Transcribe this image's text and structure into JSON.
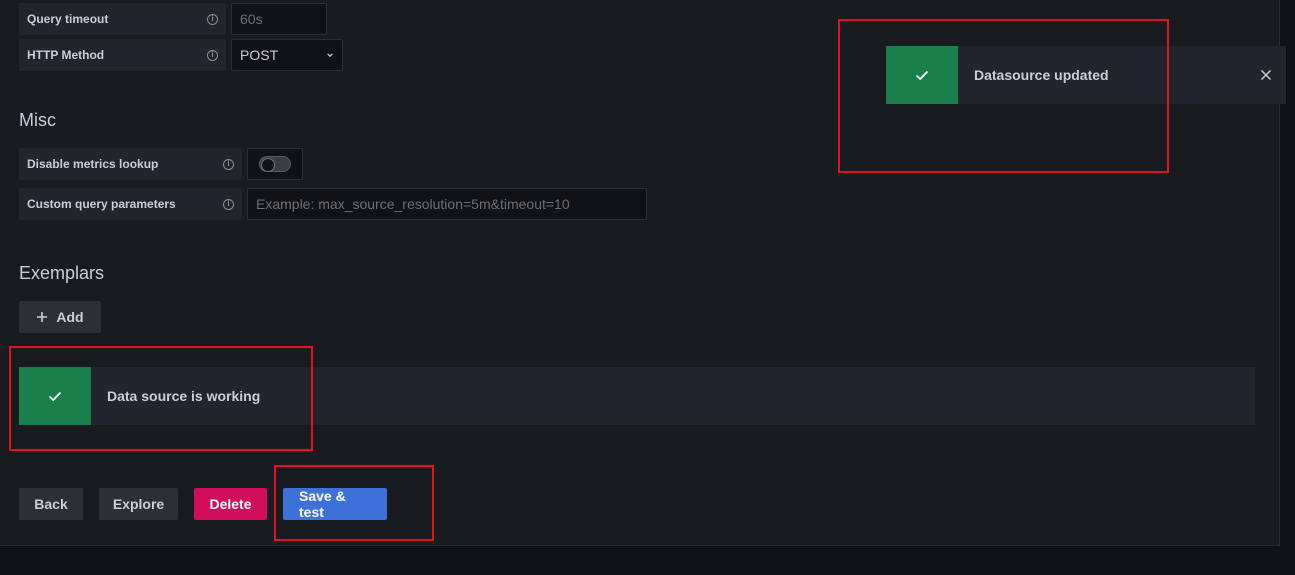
{
  "http": {
    "query_timeout": {
      "label": "Query timeout",
      "placeholder": "60s"
    },
    "http_method": {
      "label": "HTTP Method",
      "value": "POST"
    }
  },
  "misc": {
    "title": "Misc",
    "disable_metrics_lookup": {
      "label": "Disable metrics lookup",
      "enabled": false
    },
    "custom_query_parameters": {
      "label": "Custom query parameters",
      "placeholder": "Example: max_source_resolution=5m&timeout=10"
    }
  },
  "exemplars": {
    "title": "Exemplars",
    "add_label": "Add"
  },
  "status_alert": {
    "text": "Data source is working",
    "icon": "check-icon"
  },
  "toast": {
    "text": "Datasource updated",
    "icon": "check-icon",
    "close_icon": "close-icon"
  },
  "actions": {
    "back": "Back",
    "explore": "Explore",
    "delete": "Delete",
    "save_test": "Save & test"
  },
  "colors": {
    "success": "#1a7f4b",
    "primary": "#3d71d9",
    "danger": "#d10e5c",
    "highlight": "#e3131b"
  }
}
